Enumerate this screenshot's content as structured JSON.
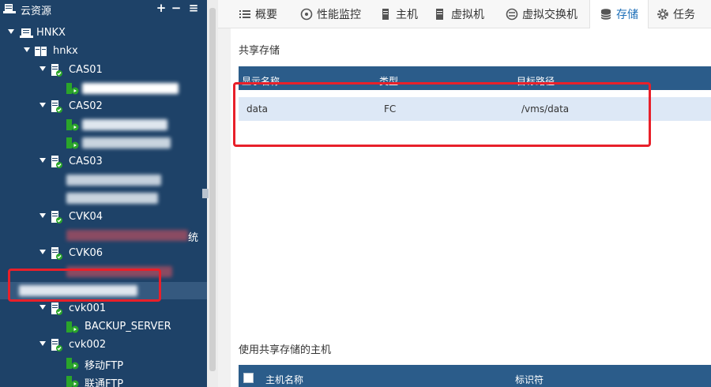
{
  "sidebar": {
    "title": "云资源",
    "add_label": "+",
    "remove_label": "−",
    "more_label": "≡",
    "root": "HNKX",
    "host_pool": "hnkx",
    "hosts": [
      {
        "name": "CAS01"
      },
      {
        "name": "CAS02"
      },
      {
        "name": "CAS03"
      },
      {
        "name": "CVK04",
        "vm_suffix": "统"
      },
      {
        "name": "CVK06"
      },
      {
        "name": "cvk001",
        "vms": [
          "BACKUP_SERVER"
        ]
      },
      {
        "name": "cvk002",
        "vms": [
          "移动FTP",
          "联通FTP"
        ]
      }
    ]
  },
  "tabs": [
    "概要",
    "性能监控",
    "主机",
    "虚拟机",
    "虚拟交换机",
    "存储",
    "任务"
  ],
  "active_tab": "存储",
  "shared_storage": {
    "title": "共享存储",
    "columns": [
      "显示名称",
      "类型",
      "目标路径"
    ],
    "rows": [
      {
        "name": "data",
        "type": "FC",
        "path": "/vms/data"
      }
    ]
  },
  "hosts_using_storage": {
    "title": "使用共享存储的主机",
    "columns": [
      "主机名称",
      "标识符"
    ]
  },
  "colors": {
    "sidebar_bg": "#1e4268",
    "header_row": "#2b5c8a",
    "data_row": "#dde8f6",
    "accent": "#1e6fb8",
    "highlight": "#e8202a",
    "vm_icon_green": "#2aa52a"
  },
  "icons": {
    "datacenter": "server-stack-icon",
    "host": "host-server-icon",
    "vm": "vm-running-icon",
    "storage": "database-icon"
  }
}
